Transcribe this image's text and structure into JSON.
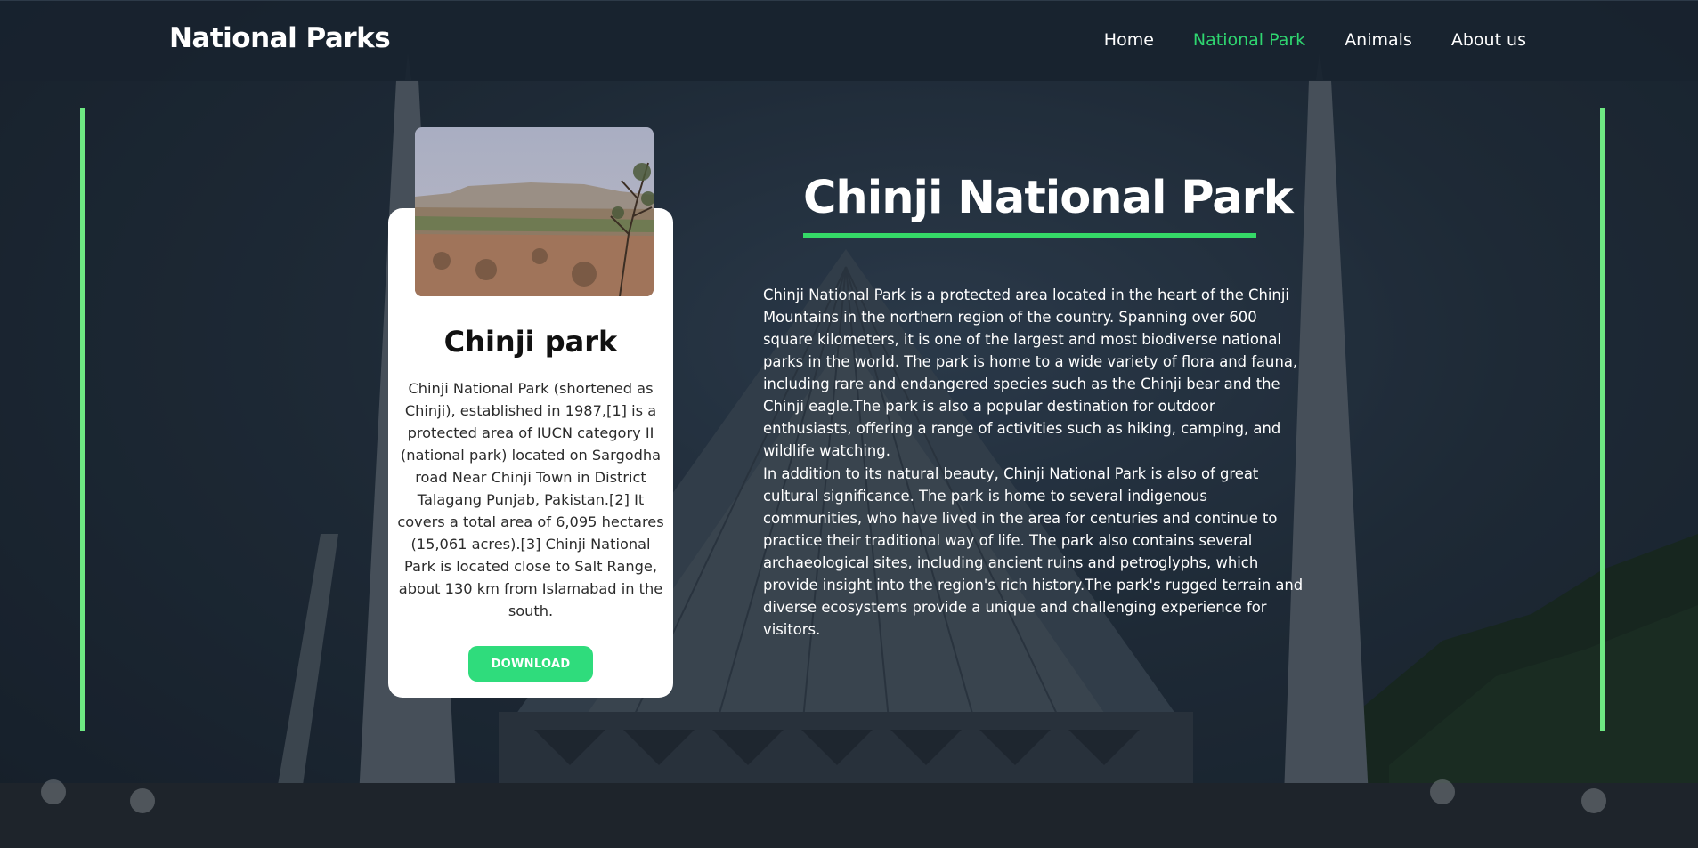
{
  "header": {
    "brand": "National Parks",
    "nav": [
      {
        "label": "Home",
        "active": false
      },
      {
        "label": "National Park",
        "active": true
      },
      {
        "label": "Animals",
        "active": false
      },
      {
        "label": "About us",
        "active": false
      }
    ]
  },
  "card": {
    "title": "Chinji park",
    "description": "Chinji National Park (shortened as Chinji), established in 1987,[1] is a protected area of IUCN category II (national park) located on Sargodha road Near Chinji Town in District Talagang Punjab, Pakistan.[2] It covers a total area of 6,095 hectares (15,061 acres).[3] Chinji National Park is located close to Salt Range, about 130 km from Islamabad in the south.",
    "button_label": "DOWNLOAD"
  },
  "main": {
    "title": "Chinji National Park",
    "paragraphs": [
      "Chinji National Park is a protected area located in the heart of the Chinji Mountains in the northern region of the country. Spanning over 600 square kilometers, it is one of the largest and most biodiverse national parks in the world. The park is home to a wide variety of flora and fauna, including rare and endangered species such as the Chinji bear and the Chinji eagle.The park is also a popular destination for outdoor enthusiasts, offering a range of activities such as hiking, camping, and wildlife watching.",
      "In addition to its natural beauty, Chinji National Park is also of great cultural significance. The park is home to several indigenous communities, who have lived in the area for centuries and continue to practice their traditional way of life. The park also contains several archaeological sites, including ancient ruins and petroglyphs, which provide insight into the region's rich history.The park's rugged terrain and diverse ecosystems provide a unique and challenging experience for visitors."
    ]
  },
  "colors": {
    "accent": "#2fd670",
    "side_line": "#6ee882",
    "button": "#2fdc7c",
    "header_bg": "#18232f"
  }
}
